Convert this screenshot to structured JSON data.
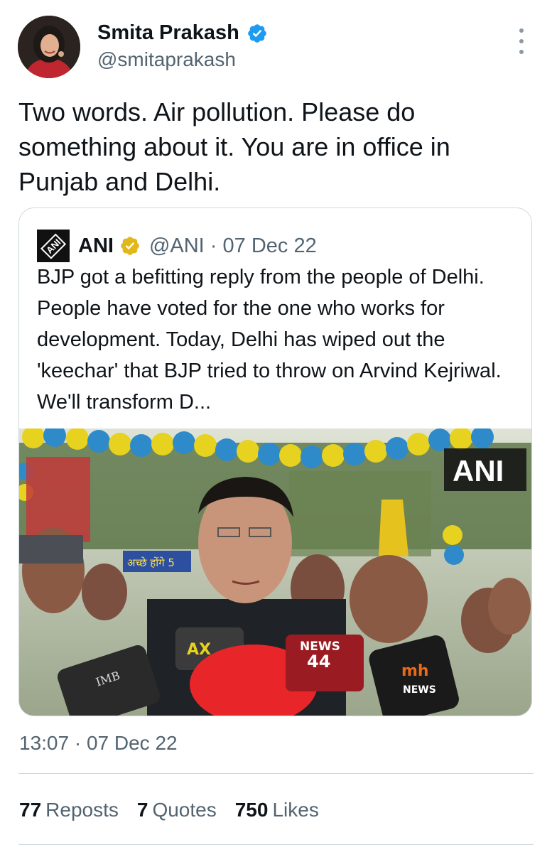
{
  "author": {
    "display_name": "Smita Prakash",
    "handle": "@smitaprakash",
    "verified_color": "#1d9bf0"
  },
  "tweet": {
    "text": "Two words. Air pollution. Please do something about it. You are in office in Punjab and Delhi."
  },
  "quoted_tweet": {
    "logo_text": "ANI",
    "name": "ANI",
    "handle": "@ANI",
    "separator": " · ",
    "date": "07 Dec 22",
    "badge_color": "#e2b719",
    "text": "BJP got a befitting reply from the people of Delhi. People have voted for the one who works for development. Today, Delhi has wiped out the 'keechar' that BJP tried to throw on Arvind Kejriwal. We'll transform D...",
    "image": {
      "watermark": "ANI",
      "mic_labels": [
        "NEWS",
        "44",
        "mh",
        "NEWS",
        "AX",
        "IMB"
      ],
      "banner_text": "अच्छे होंगे 5"
    }
  },
  "timestamp": "13:07 · 07 Dec 22",
  "stats": [
    {
      "count": "77",
      "label": "Reposts"
    },
    {
      "count": "7",
      "label": "Quotes"
    },
    {
      "count": "750",
      "label": "Likes"
    }
  ]
}
